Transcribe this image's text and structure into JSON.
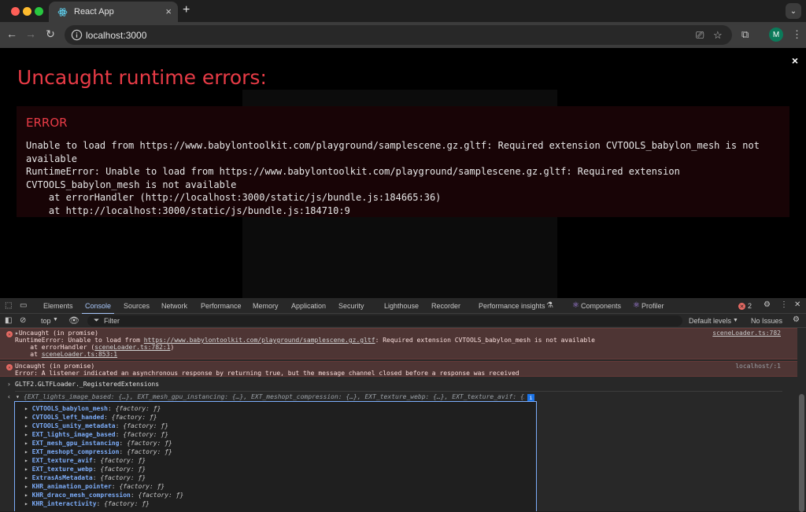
{
  "browser": {
    "tab_title": "React App",
    "new_tab": "+",
    "tab_close": "×",
    "url": "localhost:3000",
    "profile_initial": "M"
  },
  "overlay": {
    "title": "Uncaught runtime errors:",
    "close": "×",
    "error_label": "ERROR",
    "error_message": "Unable to load from https://www.babylontoolkit.com/playground/samplescene.gz.gltf: Required extension CVTOOLS_babylon_mesh is not available\nRuntimeError: Unable to load from https://www.babylontoolkit.com/playground/samplescene.gz.gltf: Required extension CVTOOLS_babylon_mesh is not available\n    at errorHandler (http://localhost:3000/static/js/bundle.js:184665:36)\n    at http://localhost:3000/static/js/bundle.js:184710:9"
  },
  "devtools": {
    "tabs": [
      "Elements",
      "Console",
      "Sources",
      "Network",
      "Performance",
      "Memory",
      "Application",
      "Security",
      "Lighthouse",
      "Recorder",
      "Performance insights",
      "Components",
      "Profiler"
    ],
    "active_tab": "Console",
    "issues_count": "2",
    "context": "top",
    "filter_placeholder": "Filter",
    "levels": "Default levels",
    "no_issues": "No Issues"
  },
  "console": {
    "error1": {
      "header": "Uncaught (in promise)",
      "line1_prefix": "RuntimeError: Unable to load from ",
      "line1_link": "https://www.babylontoolkit.com/playground/samplescene.gz.gltf",
      "line1_suffix": ": Required extension CVTOOLS_babylon_mesh is not available",
      "line2_prefix": "    at errorHandler (",
      "line2_link": "sceneLoader.ts:782:1",
      "line2_suffix": ")",
      "line3_prefix": "    at ",
      "line3_link": "sceneLoader.ts:853:1",
      "source": "sceneLoader.ts:782"
    },
    "error2": {
      "header": "Uncaught (in promise)",
      "message": "Error: A listener indicated an asynchronous response by returning true, but the message channel closed before a response was received",
      "source": "localhost/:1"
    },
    "command": "GLTF2.GLTFLoader._RegisteredExtensions",
    "result_preview": "{EXT_lights_image_based: {…}, EXT_mesh_gpu_instancing: {…}, EXT_meshopt_compression: {…}, EXT_texture_webp: {…}, EXT_texture_avif: {…}, …}",
    "properties": [
      {
        "key": "CVTOOLS_babylon_mesh",
        "value": "{factory: ƒ}"
      },
      {
        "key": "CVTOOLS_left_handed",
        "value": "{factory: ƒ}"
      },
      {
        "key": "CVTOOLS_unity_metadata",
        "value": "{factory: ƒ}"
      },
      {
        "key": "EXT_lights_image_based",
        "value": "{factory: ƒ}"
      },
      {
        "key": "EXT_mesh_gpu_instancing",
        "value": "{factory: ƒ}"
      },
      {
        "key": "EXT_meshopt_compression",
        "value": "{factory: ƒ}"
      },
      {
        "key": "EXT_texture_avif",
        "value": "{factory: ƒ}"
      },
      {
        "key": "EXT_texture_webp",
        "value": "{factory: ƒ}"
      },
      {
        "key": "ExtrasAsMetadata",
        "value": "{factory: ƒ}"
      },
      {
        "key": "KHR_animation_pointer",
        "value": "{factory: ƒ}"
      },
      {
        "key": "KHR_draco_mesh_compression",
        "value": "{factory: ƒ}"
      },
      {
        "key": "KHR_interactivity",
        "value": "{factory: ƒ}"
      }
    ]
  },
  "colors": {
    "error_red": "#e83b46",
    "console_error_bg": "#4e3534",
    "devtools_accent": "#a8c7fa",
    "property_key": "#7cacf8"
  }
}
